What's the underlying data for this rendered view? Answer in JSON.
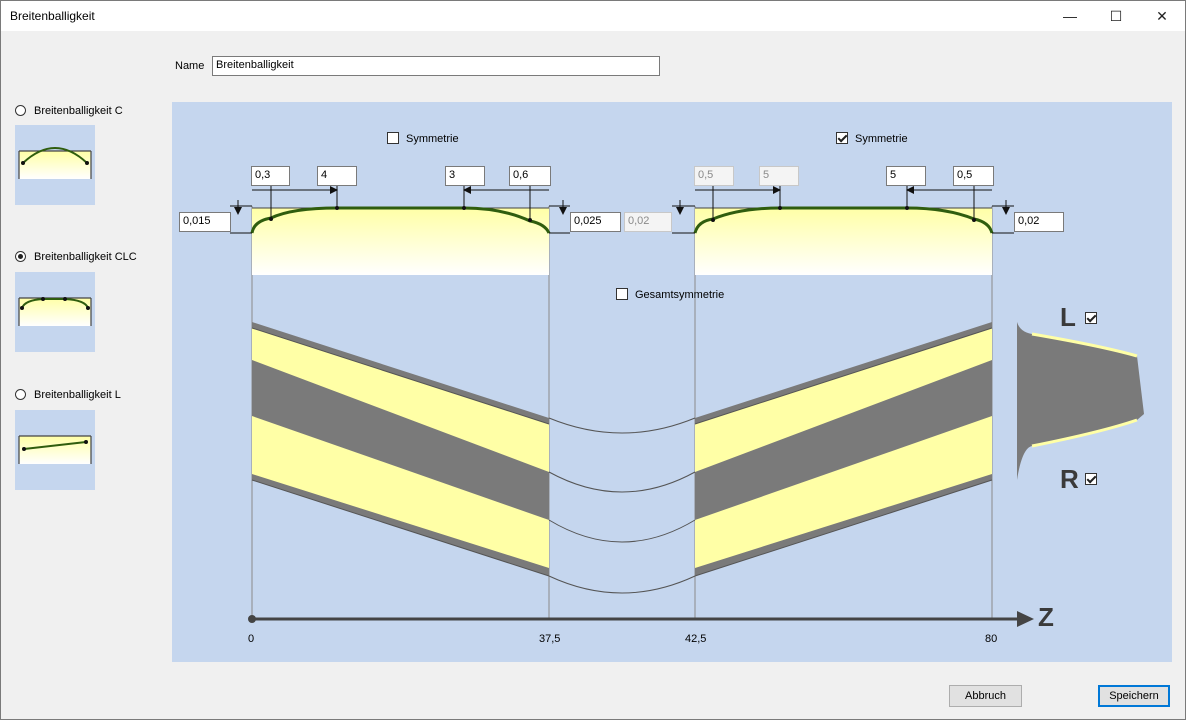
{
  "window": {
    "title": "Breitenballigkeit",
    "minimize": "—",
    "maximize": "☐",
    "close": "✕"
  },
  "name": {
    "label": "Name",
    "value": "Breitenballigkeit"
  },
  "types": [
    {
      "label": "Breitenballigkeit C",
      "selected": false
    },
    {
      "label": "Breitenballigkeit CLC",
      "selected": true
    },
    {
      "label": "Breitenballigkeit L",
      "selected": false
    }
  ],
  "left_profile": {
    "symmetry_label": "Symmetrie",
    "symmetry_checked": false,
    "b_left": "0,3",
    "len_left": "4",
    "len_right": "3",
    "b_right": "0,6",
    "c_left": "0,015",
    "c_right": "0,025"
  },
  "right_profile": {
    "symmetry_label": "Symmetrie",
    "symmetry_checked": true,
    "b_left": "0,5",
    "len_left": "5",
    "len_right": "5",
    "b_right": "0,5",
    "c_left": "0,02",
    "c_right": "0,02"
  },
  "total_symmetry": {
    "label": "Gesamtsymmetrie",
    "checked": false
  },
  "flank": {
    "l_label": "L",
    "l_checked": true,
    "r_label": "R",
    "r_checked": true
  },
  "axis": {
    "label": "Z",
    "ticks": [
      "0",
      "37,5",
      "42,5",
      "80"
    ]
  },
  "buttons": {
    "cancel": "Abbruch",
    "save": "Speichern"
  },
  "colors": {
    "panel": "#c5d6ee",
    "crown": "#2f5d0e",
    "band": "#ffffa6",
    "gear": "#7a7a7a"
  }
}
